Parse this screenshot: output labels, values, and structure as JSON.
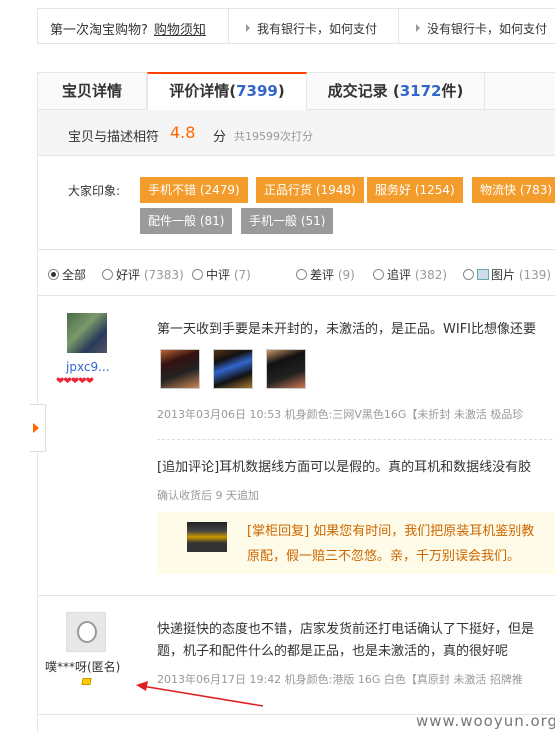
{
  "helpbar": {
    "question": "第一次淘宝购物?",
    "link": "购物须知",
    "items": [
      "我有银行卡，如何支付",
      "没有银行卡，如何支付"
    ]
  },
  "tabs": [
    {
      "label": "宝贝详情",
      "count": "",
      "suffix": ""
    },
    {
      "label": "评价详情(",
      "count": "7399",
      "suffix": ")"
    },
    {
      "label": "成交记录 (",
      "count": "3172",
      "suffix": "件)"
    }
  ],
  "rating": {
    "label": "宝贝与描述相符",
    "score": "4.8",
    "unit": "分",
    "total": "共19599次打分"
  },
  "impressions": {
    "label": "大家印象:",
    "tags": [
      {
        "text": "手机不错 (2479)",
        "style": "orange"
      },
      {
        "text": "正品行货 (1948)",
        "style": "orange"
      },
      {
        "text": "服务好 (1254)",
        "style": "orange"
      },
      {
        "text": "物流快 (783)",
        "style": "orange"
      },
      {
        "text": "配件一般 (81)",
        "style": "gray"
      },
      {
        "text": "手机一般 (51)",
        "style": "gray"
      }
    ]
  },
  "filters": [
    {
      "label": "全部",
      "count": "",
      "selected": true
    },
    {
      "label": "好评",
      "count": "(7383)",
      "selected": false
    },
    {
      "label": "中评",
      "count": "(7)",
      "selected": false
    },
    {
      "label": "差评",
      "count": "(9)",
      "selected": false
    },
    {
      "label": "追评",
      "count": "(382)",
      "selected": false
    },
    {
      "label": "图片",
      "count": "(139)",
      "selected": false
    }
  ],
  "reviews": [
    {
      "user": "jpxc9...",
      "text": "第一天收到手要是未开封的，未激活的，是正品。WIFI比想像还要",
      "meta": "2013年03月06日 10:53   机身颜色:三网V黑色16G【未折封 未激活 极品珍",
      "append_text": "[追加评论]耳机数据线方面可以是假的。真的耳机和数据线没有胶",
      "append_meta": "确认收货后 9 天追加",
      "reply_line1": "[掌柜回复] 如果您有时间，我们把原装耳机鉴别教",
      "reply_line2": "原配，假一赔三不忽悠。亲，千万别误会我们。"
    },
    {
      "user": "噗***呀(匿名)",
      "text1": "快递挺快的态度也不错，店家发货前还打电话确认了下挺好，但是",
      "text2": "题，机子和配件什么的都是正品，也是未激活的，真的很好呢",
      "meta": "2013年06月17日 19:42   机身颜色:港版 16G 白色【真原封 未激活 招牌推"
    }
  ],
  "watermark": "www.wooyun.org",
  "colors": {
    "accent": "#ff4400",
    "tag_orange": "#f39c2c",
    "tag_gray": "#9a9a9a",
    "link": "#3366cc",
    "score": "#ff6600"
  }
}
